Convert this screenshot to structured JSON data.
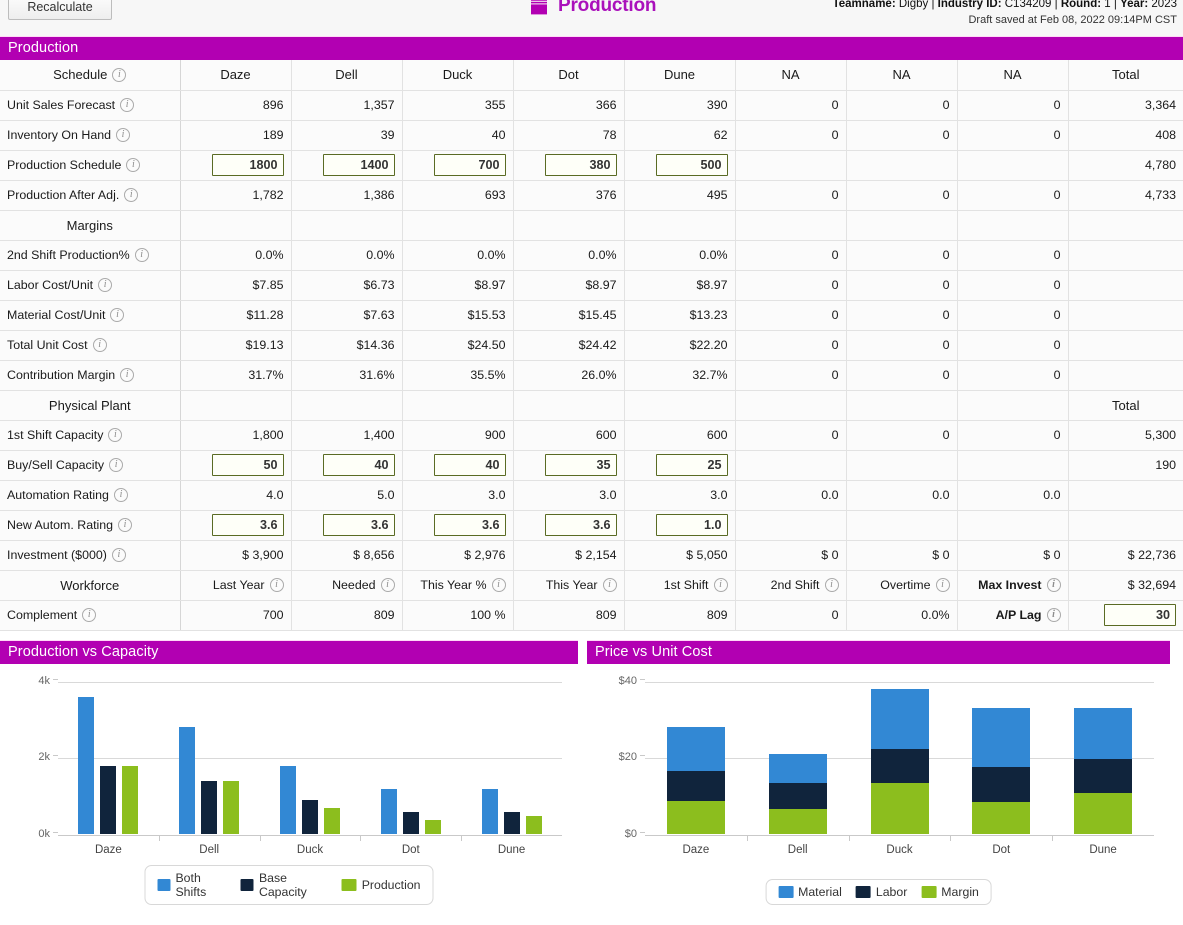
{
  "toolbar": {
    "recalculate_label": "Recalculate"
  },
  "header": {
    "page_icon": "factory-icon",
    "page_title": "Production",
    "teamname_label": "Teamname:",
    "teamname_value": "Digby",
    "industry_label": "Industry ID:",
    "industry_value": "C134209",
    "round_label": "Round:",
    "round_value": "1",
    "year_label": "Year:",
    "year_value": "2023",
    "draft_saved": "Draft saved at Feb 08, 2022 09:14PM CST",
    "accent_color": "#b200b2"
  },
  "section": {
    "title": "Production"
  },
  "columns": [
    "Schedule",
    "Daze",
    "Dell",
    "Duck",
    "Dot",
    "Dune",
    "NA",
    "NA",
    "NA",
    "Total"
  ],
  "schedule": {
    "header": "Schedule",
    "rows": [
      {
        "label": "Unit Sales Forecast",
        "type": "text",
        "values": [
          "896",
          "1,357",
          "355",
          "366",
          "390",
          "0",
          "0",
          "0"
        ],
        "total": "3,364"
      },
      {
        "label": "Inventory On Hand",
        "type": "text",
        "values": [
          "189",
          "39",
          "40",
          "78",
          "62",
          "0",
          "0",
          "0"
        ],
        "total": "408"
      },
      {
        "label": "Production Schedule",
        "type": "input",
        "values": [
          "1800",
          "1400",
          "700",
          "380",
          "500",
          "",
          "",
          ""
        ],
        "total": "4,780"
      },
      {
        "label": "Production After Adj.",
        "type": "text",
        "values": [
          "1,782",
          "1,386",
          "693",
          "376",
          "495",
          "0",
          "0",
          "0"
        ],
        "total": "4,733"
      }
    ]
  },
  "margins": {
    "header": "Margins",
    "rows": [
      {
        "label": "2nd Shift Production%",
        "type": "text",
        "values": [
          "0.0%",
          "0.0%",
          "0.0%",
          "0.0%",
          "0.0%",
          "0",
          "0",
          "0"
        ],
        "total": ""
      },
      {
        "label": "Labor Cost/Unit",
        "type": "text",
        "values": [
          "$7.85",
          "$6.73",
          "$8.97",
          "$8.97",
          "$8.97",
          "0",
          "0",
          "0"
        ],
        "total": ""
      },
      {
        "label": "Material Cost/Unit",
        "type": "text",
        "values": [
          "$11.28",
          "$7.63",
          "$15.53",
          "$15.45",
          "$13.23",
          "0",
          "0",
          "0"
        ],
        "total": ""
      },
      {
        "label": "Total Unit Cost",
        "type": "text",
        "values": [
          "$19.13",
          "$14.36",
          "$24.50",
          "$24.42",
          "$22.20",
          "0",
          "0",
          "0"
        ],
        "total": ""
      },
      {
        "label": "Contribution Margin",
        "type": "text",
        "values": [
          "31.7%",
          "31.6%",
          "35.5%",
          "26.0%",
          "32.7%",
          "0",
          "0",
          "0"
        ],
        "total": ""
      }
    ]
  },
  "physical_plant": {
    "header": "Physical Plant",
    "total_header": "Total",
    "rows": [
      {
        "label": "1st Shift Capacity",
        "type": "text",
        "values": [
          "1,800",
          "1,400",
          "900",
          "600",
          "600",
          "0",
          "0",
          "0"
        ],
        "total": "5,300"
      },
      {
        "label": "Buy/Sell Capacity",
        "type": "input",
        "values": [
          "50",
          "40",
          "40",
          "35",
          "25",
          "",
          "",
          ""
        ],
        "total": "190"
      },
      {
        "label": "Automation Rating",
        "type": "text",
        "values": [
          "4.0",
          "5.0",
          "3.0",
          "3.0",
          "3.0",
          "0.0",
          "0.0",
          "0.0"
        ],
        "total": ""
      },
      {
        "label": "New Autom. Rating",
        "type": "input",
        "values": [
          "3.6",
          "3.6",
          "3.6",
          "3.6",
          "1.0",
          "",
          "",
          ""
        ],
        "total": ""
      },
      {
        "label": "Investment ($000)",
        "type": "text",
        "values": [
          "$ 3,900",
          "$ 8,656",
          "$ 2,976",
          "$ 2,154",
          "$ 5,050",
          "$ 0",
          "$ 0",
          "$ 0"
        ],
        "total": "$ 22,736"
      }
    ]
  },
  "workforce": {
    "header": "Workforce",
    "col_headers": [
      {
        "label": "Last Year",
        "info": true,
        "bold": false
      },
      {
        "label": "Needed",
        "info": true,
        "bold": false
      },
      {
        "label": "This Year %",
        "info": true,
        "bold": false
      },
      {
        "label": "This Year",
        "info": true,
        "bold": false
      },
      {
        "label": "1st Shift",
        "info": true,
        "bold": false
      },
      {
        "label": "2nd Shift",
        "info": true,
        "bold": false
      },
      {
        "label": "Overtime",
        "info": true,
        "bold": false
      },
      {
        "label": "Max Invest",
        "info": true,
        "bold": true
      }
    ],
    "max_invest_value": "$ 32,694",
    "complement_label": "Complement",
    "complement_values": [
      "700",
      "809",
      "100 %",
      "809",
      "809",
      "0",
      "0.0%"
    ],
    "ap_lag_label": "A/P Lag",
    "ap_lag_value": "30"
  },
  "chart_data": [
    {
      "panel_title": "Production vs Capacity",
      "type": "bar",
      "categories": [
        "Daze",
        "Dell",
        "Duck",
        "Dot",
        "Dune"
      ],
      "series": [
        {
          "name": "Both Shifts",
          "color": "#3288d4",
          "values": [
            3600,
            2800,
            1800,
            1200,
            1200
          ]
        },
        {
          "name": "Base Capacity",
          "color": "#10243c",
          "values": [
            1800,
            1400,
            900,
            600,
            600
          ]
        },
        {
          "name": "Production",
          "color": "#8cbe1e",
          "values": [
            1782,
            1386,
            693,
            376,
            495
          ]
        }
      ],
      "ylim": [
        0,
        4000
      ],
      "yticks": [
        0,
        2000,
        4000
      ],
      "ytick_labels": [
        "0k",
        "2k",
        "4k"
      ],
      "xlabel": "",
      "ylabel": "",
      "grid": true,
      "legend_position": "bottom"
    },
    {
      "panel_title": "Price vs Unit Cost",
      "type": "bar",
      "stacked": true,
      "categories": [
        "Daze",
        "Dell",
        "Duck",
        "Dot",
        "Dune"
      ],
      "series": [
        {
          "name": "Material",
          "color": "#3288d4",
          "values": [
            11.28,
            7.63,
            15.53,
            15.45,
            13.23
          ]
        },
        {
          "name": "Labor",
          "color": "#10243c",
          "values": [
            7.85,
            6.73,
            8.97,
            8.97,
            8.97
          ]
        },
        {
          "name": "Margin",
          "color": "#8cbe1e",
          "values": [
            8.87,
            6.64,
            13.5,
            8.58,
            10.8
          ]
        }
      ],
      "stack_order_bottom_to_top": [
        "Margin",
        "Labor",
        "Material"
      ],
      "ylim": [
        0,
        40
      ],
      "yticks": [
        0,
        20,
        40
      ],
      "ytick_labels": [
        "$0",
        "$20",
        "$40"
      ],
      "xlabel": "",
      "ylabel": "",
      "grid": true,
      "legend_position": "bottom"
    }
  ]
}
